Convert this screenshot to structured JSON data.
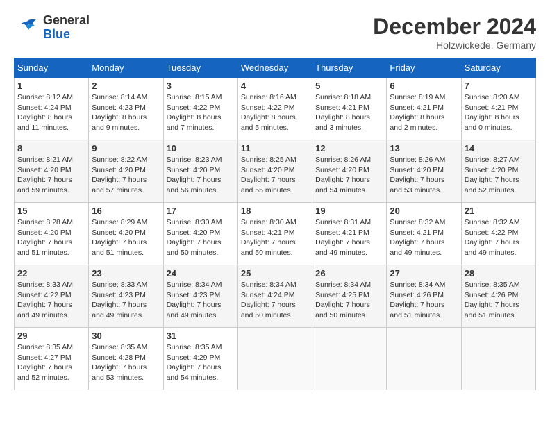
{
  "header": {
    "logo_line1": "General",
    "logo_line2": "Blue",
    "month_year": "December 2024",
    "location": "Holzwickede, Germany"
  },
  "weekdays": [
    "Sunday",
    "Monday",
    "Tuesday",
    "Wednesday",
    "Thursday",
    "Friday",
    "Saturday"
  ],
  "weeks": [
    [
      {
        "day": "1",
        "sunrise": "8:12 AM",
        "sunset": "4:24 PM",
        "daylight": "8 hours and 11 minutes."
      },
      {
        "day": "2",
        "sunrise": "8:14 AM",
        "sunset": "4:23 PM",
        "daylight": "8 hours and 9 minutes."
      },
      {
        "day": "3",
        "sunrise": "8:15 AM",
        "sunset": "4:22 PM",
        "daylight": "8 hours and 7 minutes."
      },
      {
        "day": "4",
        "sunrise": "8:16 AM",
        "sunset": "4:22 PM",
        "daylight": "8 hours and 5 minutes."
      },
      {
        "day": "5",
        "sunrise": "8:18 AM",
        "sunset": "4:21 PM",
        "daylight": "8 hours and 3 minutes."
      },
      {
        "day": "6",
        "sunrise": "8:19 AM",
        "sunset": "4:21 PM",
        "daylight": "8 hours and 2 minutes."
      },
      {
        "day": "7",
        "sunrise": "8:20 AM",
        "sunset": "4:21 PM",
        "daylight": "8 hours and 0 minutes."
      }
    ],
    [
      {
        "day": "8",
        "sunrise": "8:21 AM",
        "sunset": "4:20 PM",
        "daylight": "7 hours and 59 minutes."
      },
      {
        "day": "9",
        "sunrise": "8:22 AM",
        "sunset": "4:20 PM",
        "daylight": "7 hours and 57 minutes."
      },
      {
        "day": "10",
        "sunrise": "8:23 AM",
        "sunset": "4:20 PM",
        "daylight": "7 hours and 56 minutes."
      },
      {
        "day": "11",
        "sunrise": "8:25 AM",
        "sunset": "4:20 PM",
        "daylight": "7 hours and 55 minutes."
      },
      {
        "day": "12",
        "sunrise": "8:26 AM",
        "sunset": "4:20 PM",
        "daylight": "7 hours and 54 minutes."
      },
      {
        "day": "13",
        "sunrise": "8:26 AM",
        "sunset": "4:20 PM",
        "daylight": "7 hours and 53 minutes."
      },
      {
        "day": "14",
        "sunrise": "8:27 AM",
        "sunset": "4:20 PM",
        "daylight": "7 hours and 52 minutes."
      }
    ],
    [
      {
        "day": "15",
        "sunrise": "8:28 AM",
        "sunset": "4:20 PM",
        "daylight": "7 hours and 51 minutes."
      },
      {
        "day": "16",
        "sunrise": "8:29 AM",
        "sunset": "4:20 PM",
        "daylight": "7 hours and 51 minutes."
      },
      {
        "day": "17",
        "sunrise": "8:30 AM",
        "sunset": "4:20 PM",
        "daylight": "7 hours and 50 minutes."
      },
      {
        "day": "18",
        "sunrise": "8:30 AM",
        "sunset": "4:21 PM",
        "daylight": "7 hours and 50 minutes."
      },
      {
        "day": "19",
        "sunrise": "8:31 AM",
        "sunset": "4:21 PM",
        "daylight": "7 hours and 49 minutes."
      },
      {
        "day": "20",
        "sunrise": "8:32 AM",
        "sunset": "4:21 PM",
        "daylight": "7 hours and 49 minutes."
      },
      {
        "day": "21",
        "sunrise": "8:32 AM",
        "sunset": "4:22 PM",
        "daylight": "7 hours and 49 minutes."
      }
    ],
    [
      {
        "day": "22",
        "sunrise": "8:33 AM",
        "sunset": "4:22 PM",
        "daylight": "7 hours and 49 minutes."
      },
      {
        "day": "23",
        "sunrise": "8:33 AM",
        "sunset": "4:23 PM",
        "daylight": "7 hours and 49 minutes."
      },
      {
        "day": "24",
        "sunrise": "8:34 AM",
        "sunset": "4:23 PM",
        "daylight": "7 hours and 49 minutes."
      },
      {
        "day": "25",
        "sunrise": "8:34 AM",
        "sunset": "4:24 PM",
        "daylight": "7 hours and 50 minutes."
      },
      {
        "day": "26",
        "sunrise": "8:34 AM",
        "sunset": "4:25 PM",
        "daylight": "7 hours and 50 minutes."
      },
      {
        "day": "27",
        "sunrise": "8:34 AM",
        "sunset": "4:26 PM",
        "daylight": "7 hours and 51 minutes."
      },
      {
        "day": "28",
        "sunrise": "8:35 AM",
        "sunset": "4:26 PM",
        "daylight": "7 hours and 51 minutes."
      }
    ],
    [
      {
        "day": "29",
        "sunrise": "8:35 AM",
        "sunset": "4:27 PM",
        "daylight": "7 hours and 52 minutes."
      },
      {
        "day": "30",
        "sunrise": "8:35 AM",
        "sunset": "4:28 PM",
        "daylight": "7 hours and 53 minutes."
      },
      {
        "day": "31",
        "sunrise": "8:35 AM",
        "sunset": "4:29 PM",
        "daylight": "7 hours and 54 minutes."
      },
      null,
      null,
      null,
      null
    ]
  ]
}
